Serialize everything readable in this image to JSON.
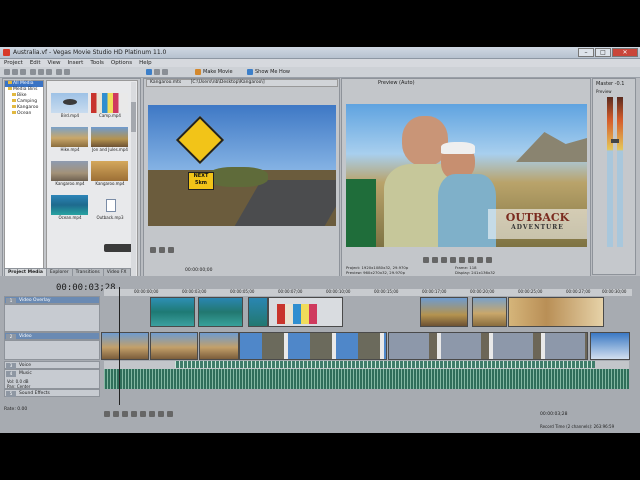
{
  "window": {
    "title": "Australia.vf - Vegas Movie Studio HD Platinum 11.0",
    "buttons": {
      "minimize": "–",
      "maximize": "□",
      "close": "✕"
    }
  },
  "menu": [
    "Project",
    "Edit",
    "View",
    "Insert",
    "Tools",
    "Options",
    "Help"
  ],
  "toolbar": {
    "make_movie": "Make Movie",
    "show_me_how": "Show Me How"
  },
  "tree": {
    "items": [
      "All Media",
      "Media Bins",
      "Bike",
      "Camping",
      "Kangaroo",
      "Ocean"
    ]
  },
  "media": [
    {
      "name": "Bird.mp4",
      "thumb": "bird"
    },
    {
      "name": "Camp.mp4",
      "thumb": "beachhuts"
    },
    {
      "name": "Hike.mp4",
      "thumb": "hike"
    },
    {
      "name": "Jon and Jules.mp4",
      "thumb": "couple"
    },
    {
      "name": "Kangaroo.mp4",
      "thumb": "kangaroo"
    },
    {
      "name": "Kangaroo.mp4",
      "thumb": "sign"
    },
    {
      "name": "Ocean.mp4",
      "thumb": "ocean"
    },
    {
      "name": "Outback.mp3",
      "thumb": "audio"
    }
  ],
  "tabs": [
    "Project Media",
    "Explorer",
    "Transitions",
    "Video FX"
  ],
  "trimmer": {
    "file": "Kangaroo.mts",
    "path": "[C:\\Users\\nb\\Desktop\\Kangaroo\\]",
    "sign_text": "NEXT",
    "sign_dist": "5km",
    "time": "00:00:00;00"
  },
  "preview": {
    "label": "Preview (Auto)",
    "title1": "OUTBACK",
    "title2": "ADVENTURE",
    "info": {
      "project_label": "Project:",
      "project_value": "1920x1080x32, 29.970p",
      "preview_label": "Preview:",
      "preview_value": "960x270x32, 29.970p",
      "frame_label": "Frame:",
      "frame_value": "118",
      "display_label": "Display:",
      "display_value": "241x136x32"
    }
  },
  "master": {
    "label": "Master",
    "value": "-0.1",
    "sub": "Preview"
  },
  "timeline": {
    "timecode": "00:00:03;28",
    "tracks": [
      "Video Overlay",
      "Video",
      "Voice",
      "Music",
      "Sound Effects"
    ],
    "track_params": {
      "vol": "Vol:",
      "vol_value": "0.0 dB",
      "pan": "Pan:",
      "pan_value": "Center"
    },
    "ruler": [
      "00:00:00;00",
      "00:00:03;00",
      "00:00:05;00",
      "00:00:07;00",
      "00:00:10;00",
      "00:00:15;00",
      "00:00:17;00",
      "00:00:20;00",
      "00:00:25;00",
      "00:00:27;00",
      "00:00:30;00",
      "00:00:32;00"
    ]
  },
  "status": {
    "rate_label": "Rate: 0.00",
    "time": "00:00:03;28",
    "record": "Record Time (2 channels): 263:96:59"
  }
}
